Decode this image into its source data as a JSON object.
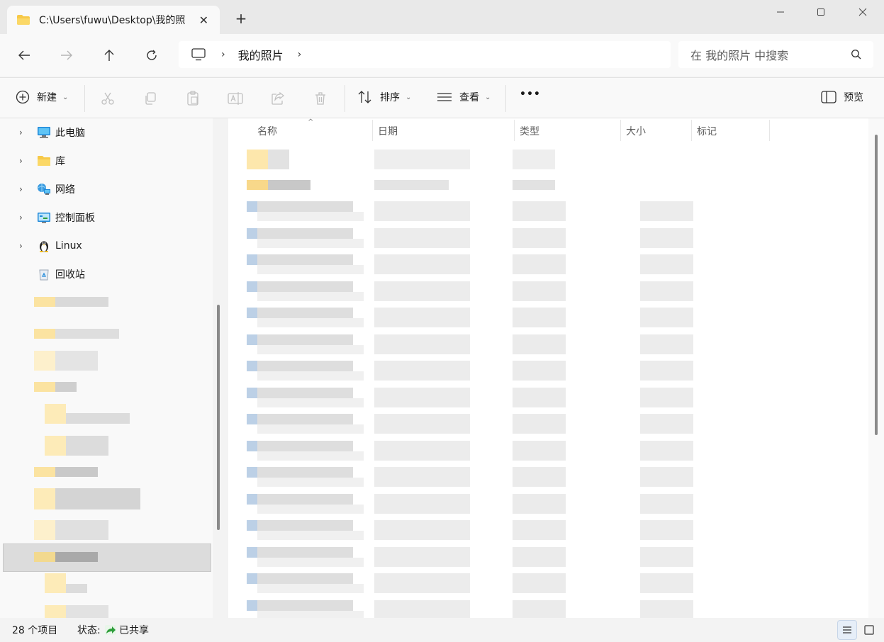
{
  "tab": {
    "title": "C:\\Users\\fuwu\\Desktop\\我的照片",
    "close_glyph": "✕",
    "new_tab_glyph": "+"
  },
  "window": {
    "minimize_glyph": "—",
    "maximize_glyph": "☐",
    "close_glyph": "✕"
  },
  "address": {
    "breadcrumb": [
      "我的照片"
    ],
    "search_placeholder": "在 我的照片 中搜索"
  },
  "commands": {
    "new_label": "新建",
    "sort_label": "排序",
    "view_label": "查看",
    "more_glyph": "•••",
    "preview_label": "预览"
  },
  "sidebar": {
    "items": [
      {
        "label": "此电脑",
        "icon": "computer-icon",
        "expandable": true
      },
      {
        "label": "库",
        "icon": "library-folder-icon",
        "expandable": true
      },
      {
        "label": "网络",
        "icon": "network-icon",
        "expandable": true
      },
      {
        "label": "控制面板",
        "icon": "control-panel-icon",
        "expandable": true
      },
      {
        "label": "Linux",
        "icon": "linux-penguin-icon",
        "expandable": true
      },
      {
        "label": "回收站",
        "icon": "recycle-bin-icon",
        "expandable": false
      }
    ],
    "expand_glyph": "›"
  },
  "columns": {
    "name": "名称",
    "date": "日期",
    "type": "类型",
    "size": "大小",
    "tags": "标记"
  },
  "status": {
    "item_count": "28 个项目",
    "state_label": "状态:",
    "state_value": "已共享"
  },
  "colors": {
    "accent": "#1a73e8",
    "folder": "#f7c948",
    "shared_green": "#2e9d3a"
  }
}
